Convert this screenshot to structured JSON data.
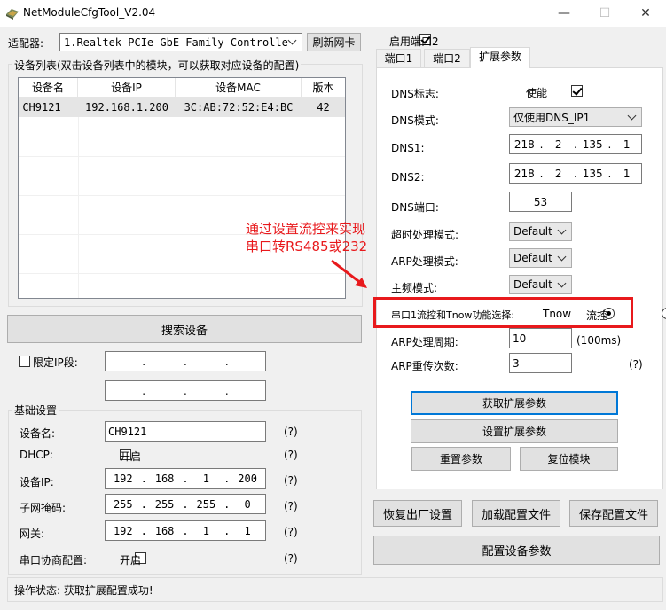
{
  "window": {
    "title": "NetModuleCfgTool_V2.04",
    "minimize": "—",
    "maximize": "☐",
    "close": "✕"
  },
  "adapter": {
    "label": "适配器:",
    "value": "1.Realtek PCIe GbE Family Controlle",
    "refresh_button": "刷新网卡"
  },
  "device_list": {
    "legend": "设备列表(双击设备列表中的模块，可以获取对应设备的配置)",
    "columns": [
      "设备名",
      "设备IP",
      "设备MAC",
      "版本"
    ],
    "rows": [
      [
        "CH9121",
        "192.168.1.200",
        "3C:AB:72:52:E4:BC",
        "42"
      ]
    ]
  },
  "search_button": "搜索设备",
  "ip_range": {
    "label": "限定IP段:",
    "start": [
      "",
      "",
      "",
      ""
    ],
    "end": [
      "",
      "",
      "",
      ""
    ]
  },
  "basic": {
    "legend": "基础设置",
    "device_name_label": "设备名:",
    "device_name_value": "CH9121",
    "dhcp_label": "DHCP:",
    "dhcp_option": "开启",
    "ip_label": "设备IP:",
    "ip_value": [
      "192",
      "168",
      "1",
      "200"
    ],
    "mask_label": "子网掩码:",
    "mask_value": [
      "255",
      "255",
      "255",
      "0"
    ],
    "gateway_label": "网关:",
    "gateway_value": [
      "192",
      "168",
      "1",
      "1"
    ],
    "negotiate_label": "串口协商配置:",
    "negotiate_option": "开启",
    "help": "(?)"
  },
  "status_bar": "操作状态: 获取扩展配置成功!",
  "enable_port2": "启用端口2",
  "tabs": [
    "端口1",
    "端口2",
    "扩展参数"
  ],
  "ext": {
    "dns_flag_label": "DNS标志:",
    "dns_flag_option": "使能",
    "dns_mode_label": "DNS模式:",
    "dns_mode_value": "仅使用DNS_IP1",
    "dns1_label": "DNS1:",
    "dns1_value": [
      "218",
      "2",
      "135",
      "1"
    ],
    "dns2_label": "DNS2:",
    "dns2_value": [
      "218",
      "2",
      "135",
      "1"
    ],
    "dns_port_label": "DNS端口:",
    "dns_port_value": "53",
    "timeout_label": "超时处理模式:",
    "timeout_value": "Default",
    "arp_mode_label": "ARP处理模式:",
    "arp_mode_value": "Default",
    "freq_label": "主频模式:",
    "freq_value": "Default",
    "flow_label": "串口1流控和Tnow功能选择:",
    "flow_opt1": "Tnow",
    "flow_opt2": "流控",
    "arp_period_label": "ARP处理周期:",
    "arp_period_value": "10",
    "arp_period_unit": "(100ms)",
    "arp_retry_label": "ARP重传次数:",
    "arp_retry_value": "3",
    "help": "(?)",
    "get_button": "获取扩展参数",
    "set_button": "设置扩展参数",
    "reset_button": "重置参数",
    "reboot_button": "复位模块"
  },
  "annotation": {
    "line1": "通过设置流控来实现",
    "line2": "串口转RS485或232",
    "color": "#e8191c"
  },
  "bottom_buttons": {
    "factory": "恢复出厂设置",
    "load": "加载配置文件",
    "save": "保存配置文件",
    "configure": "配置设备参数"
  }
}
